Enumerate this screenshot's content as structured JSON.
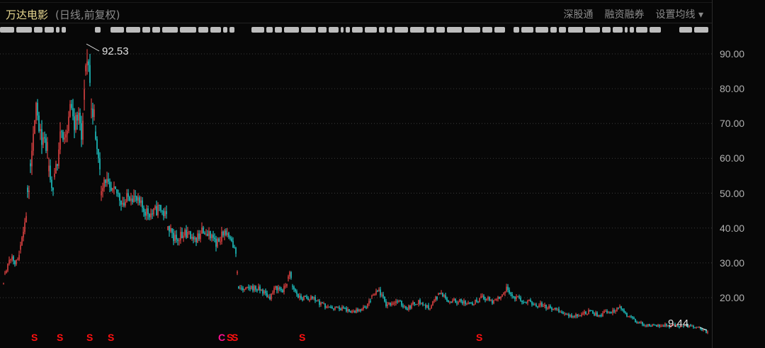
{
  "header": {
    "title": "万达电影",
    "subtitle": "(日线,前复权)",
    "links": [
      "深股通",
      "融资融券",
      "设置均线 ▾"
    ]
  },
  "colors": {
    "up": "#ff4a4a",
    "down": "#20e0e0",
    "grid": "#3a3a3a"
  },
  "chart_data": {
    "type": "candlestick",
    "ylim": [
      8,
      95
    ],
    "yticks": [
      "90.00",
      "80.00",
      "70.00",
      "60.00",
      "50.00",
      "40.00",
      "30.00",
      "20.00"
    ],
    "annotations": {
      "high": "92.53",
      "low": "9.44"
    },
    "markers": [
      {
        "day": 48,
        "label": "S"
      },
      {
        "day": 84,
        "label": "S"
      },
      {
        "day": 126,
        "label": "S"
      },
      {
        "day": 156,
        "label": "S"
      },
      {
        "day": 312,
        "label": "C"
      },
      {
        "day": 324,
        "label": "S"
      },
      {
        "day": 331,
        "label": "S"
      },
      {
        "day": 426,
        "label": "S"
      },
      {
        "day": 676,
        "label": "S"
      }
    ],
    "keyframes": [
      [
        5,
        25
      ],
      [
        15,
        32
      ],
      [
        25,
        30
      ],
      [
        35,
        40
      ],
      [
        42,
        55
      ],
      [
        50,
        75
      ],
      [
        55,
        70
      ],
      [
        60,
        65
      ],
      [
        68,
        62
      ],
      [
        73,
        50
      ],
      [
        78,
        55
      ],
      [
        85,
        67
      ],
      [
        90,
        65
      ],
      [
        95,
        70
      ],
      [
        100,
        75
      ],
      [
        105,
        70
      ],
      [
        110,
        73
      ],
      [
        115,
        68
      ],
      [
        120,
        82
      ],
      [
        124,
        90
      ],
      [
        128,
        78
      ],
      [
        133,
        72
      ],
      [
        138,
        60
      ],
      [
        143,
        52
      ],
      [
        148,
        55
      ],
      [
        155,
        50
      ],
      [
        165,
        50
      ],
      [
        175,
        47
      ],
      [
        185,
        50
      ],
      [
        195,
        47
      ],
      [
        205,
        45
      ],
      [
        215,
        44
      ],
      [
        225,
        46
      ],
      [
        235,
        43
      ],
      [
        245,
        37
      ],
      [
        255,
        38
      ],
      [
        265,
        38
      ],
      [
        275,
        36
      ],
      [
        285,
        39
      ],
      [
        295,
        38
      ],
      [
        305,
        35
      ],
      [
        315,
        39
      ],
      [
        325,
        37
      ],
      [
        332,
        34
      ],
      [
        337,
        23
      ],
      [
        345,
        22
      ],
      [
        355,
        23
      ],
      [
        370,
        22
      ],
      [
        380,
        20
      ],
      [
        390,
        23
      ],
      [
        400,
        22
      ],
      [
        410,
        27
      ],
      [
        415,
        22
      ],
      [
        425,
        20
      ],
      [
        440,
        20
      ],
      [
        455,
        18
      ],
      [
        470,
        17
      ],
      [
        485,
        17
      ],
      [
        500,
        16
      ],
      [
        515,
        17
      ],
      [
        525,
        20
      ],
      [
        535,
        22
      ],
      [
        545,
        18
      ],
      [
        560,
        19
      ],
      [
        575,
        17
      ],
      [
        590,
        19
      ],
      [
        605,
        17
      ],
      [
        620,
        21
      ],
      [
        635,
        19
      ],
      [
        650,
        19
      ],
      [
        665,
        18
      ],
      [
        680,
        20
      ],
      [
        695,
        19
      ],
      [
        705,
        20
      ],
      [
        715,
        23
      ],
      [
        725,
        20
      ],
      [
        740,
        19
      ],
      [
        760,
        18
      ],
      [
        780,
        17
      ],
      [
        800,
        15
      ],
      [
        815,
        15
      ],
      [
        830,
        16
      ],
      [
        845,
        15
      ],
      [
        860,
        16
      ],
      [
        875,
        17
      ],
      [
        885,
        15
      ],
      [
        900,
        13
      ],
      [
        915,
        12
      ],
      [
        935,
        12
      ],
      [
        950,
        12
      ],
      [
        970,
        12
      ],
      [
        990,
        11
      ],
      [
        1000,
        10
      ]
    ]
  }
}
